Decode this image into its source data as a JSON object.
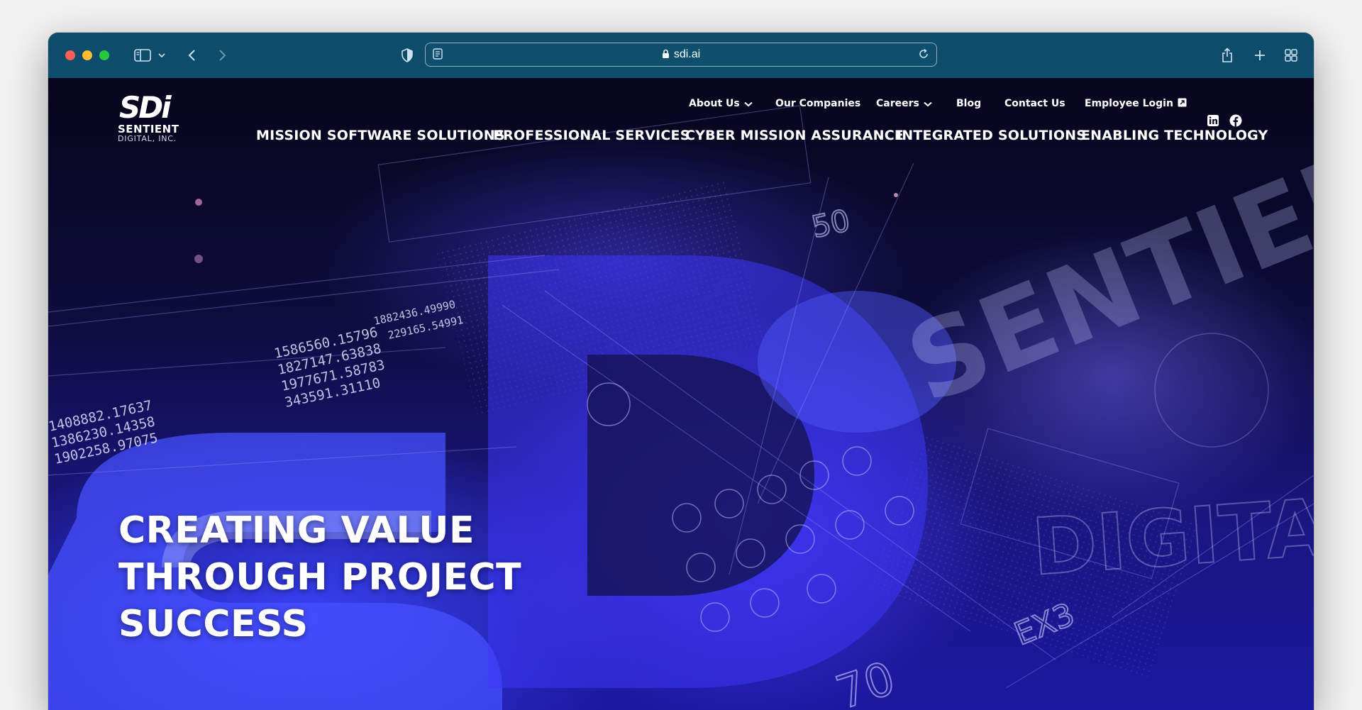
{
  "browser": {
    "url": "sdi.ai"
  },
  "logo": {
    "mark": "SDi",
    "line1": "SENTIENT",
    "line2": "DIGITAL, INC."
  },
  "top_nav": {
    "about": "About Us",
    "companies": "Our Companies",
    "careers": "Careers",
    "blog": "Blog",
    "contact": "Contact Us",
    "employee_login": "Employee Login"
  },
  "main_nav": {
    "mission_software": "MISSION SOFTWARE SOLUTIONS",
    "professional_services": "PROFESSIONAL SERVICES",
    "cyber_mission": "CYBER MISSION ASSURANCE",
    "integrated_solutions": "INTEGRATED SOLUTIONS",
    "enabling_technology": "ENABLING TECHNOLOGY"
  },
  "hero": {
    "line1": "CREATING VALUE",
    "line2": "THROUGH PROJECT",
    "line3": "SUCCESS"
  },
  "background_text": {
    "n1": "1586560.15796",
    "n2": "1827147.63838",
    "n3": "1977671.58783",
    "n4": "343591.31110",
    "n5": "1408882.17637",
    "n6": "1386230.14358",
    "n7": "1902258.97075",
    "n8": "1882436.49990",
    "n9": "229165.54991",
    "big1": "SENTIENT",
    "big2": "DIGITAL",
    "tag1": "EX3",
    "tag2": "70",
    "tag3": "50"
  },
  "colors": {
    "toolbar": "#0d4d6b",
    "page_bg": "#0b0a26",
    "accent_blue": "#3b3bff"
  }
}
